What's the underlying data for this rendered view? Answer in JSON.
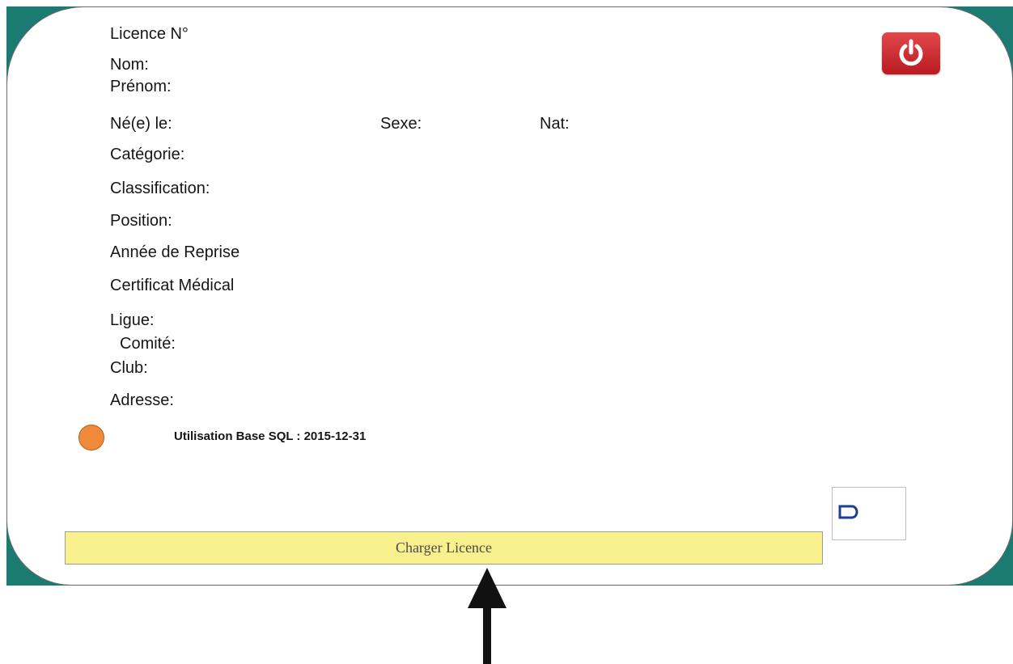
{
  "form": {
    "licence_label": "Licence N°",
    "nom_label": "Nom:",
    "prenom_label": "Prénom:",
    "ne_le_label": "Né(e) le:",
    "sexe_label": "Sexe:",
    "nat_label": "Nat:",
    "categorie_label": "Catégorie:",
    "classification_label": "Classification:",
    "position_label": "Position:",
    "annee_reprise_label": "Année de Reprise",
    "certificat_label": "Certificat Médical",
    "ligue_label": "Ligue:",
    "comite_label": "Comité:",
    "club_label": "Club:",
    "adresse_label": "Adresse:"
  },
  "status": {
    "text": "Utilisation Base SQL : 2015-12-31",
    "dot_color": "#f08a3a"
  },
  "actions": {
    "load_label": "Charger Licence",
    "power_icon": "power-icon",
    "card_reader_icon": "card-reader-icon"
  },
  "colors": {
    "frame": "#1b7a72",
    "button_bg": "#f8f08c",
    "power": "#d32f2f"
  }
}
